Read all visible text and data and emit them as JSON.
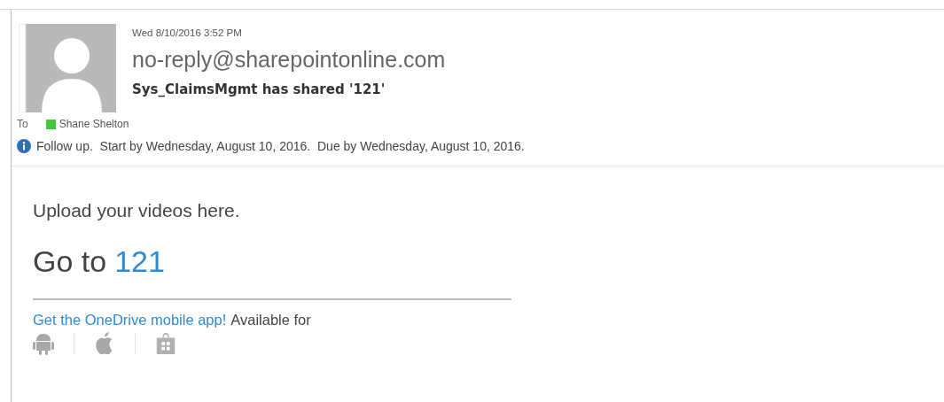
{
  "message": {
    "date": "Wed 8/10/2016 3:52 PM",
    "sender": "no-reply@sharepointonline.com",
    "subject": "Sys_ClaimsMgmt has shared '121'",
    "to_label": "To",
    "recipients": [
      {
        "name": "Shane Shelton",
        "color": "#3fc93f"
      }
    ],
    "flag": "Follow up.  Start by Wednesday, August 10, 2016.  Due by Wednesday, August 10, 2016."
  },
  "body": {
    "intro": "Upload your videos here.",
    "go_prefix": "Go to",
    "go_link": "121",
    "app_link": "Get the OneDrive mobile app!",
    "app_suffix": "Available for",
    "platforms": [
      {
        "kind": "android"
      },
      {
        "kind": "apple"
      },
      {
        "kind": "windows"
      }
    ]
  }
}
